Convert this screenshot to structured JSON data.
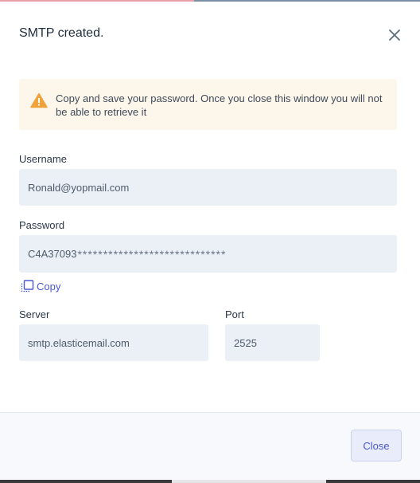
{
  "dialog": {
    "title": "SMTP created.",
    "close_icon": "close-icon"
  },
  "alert": {
    "icon": "warning-icon",
    "icon_color": "#f0a23b",
    "background": "#fdf6ea",
    "message": "Copy and save your password. Once you close this window you will not be able to retrieve it"
  },
  "username": {
    "label": "Username",
    "value": "Ronald@yopmail.com"
  },
  "password": {
    "label": "Password",
    "visible_part": "C4A37093",
    "masked_part": "*****************************"
  },
  "copy": {
    "icon": "copy-icon",
    "label": "Copy"
  },
  "server": {
    "label": "Server",
    "value": "smtp.elasticemail.com"
  },
  "port": {
    "label": "Port",
    "value": "2525"
  },
  "footer": {
    "close_label": "Close"
  },
  "colors": {
    "accent": "#4b58d6",
    "field_bg": "#ebf0f7",
    "footer_bg": "#f7f9fc"
  }
}
